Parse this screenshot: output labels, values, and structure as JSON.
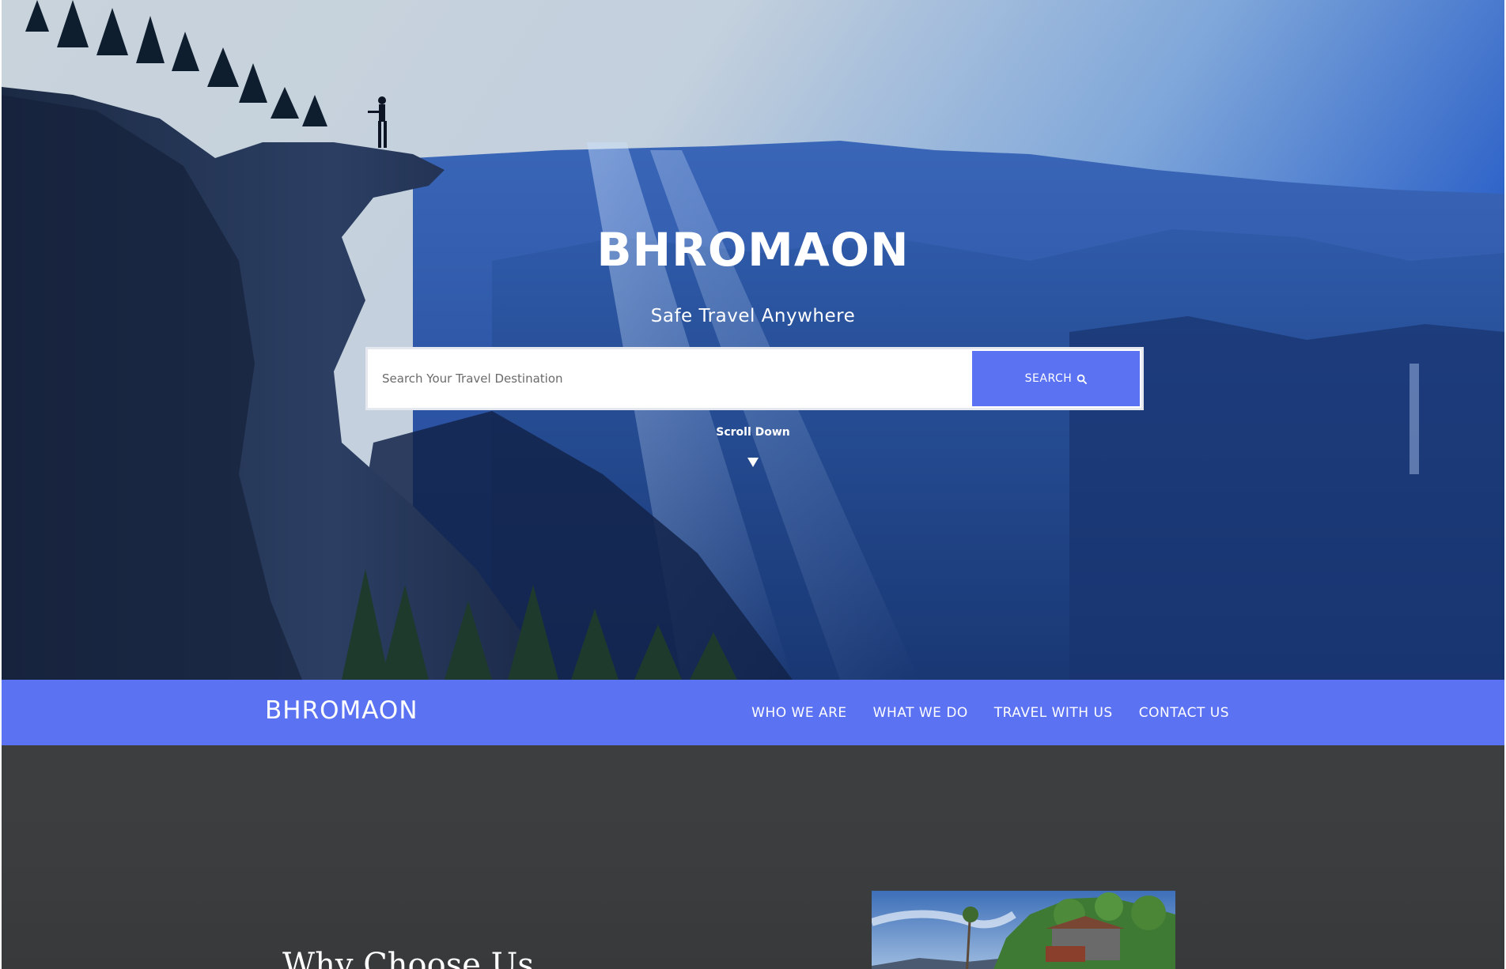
{
  "hero": {
    "title": "BHROMAON",
    "subtitle": "Safe Travel Anywhere",
    "search": {
      "placeholder": "Search Your Travel Destination",
      "button_label": "SEARCH",
      "button_icon": "search-icon"
    },
    "scroll_label": "Scroll Down",
    "scroll_icon": "triangle-down-icon"
  },
  "navbar": {
    "logo": "BHROMAON",
    "links": [
      "WHO WE ARE",
      "WHAT WE DO",
      "TRAVEL WITH US",
      "CONTACT US"
    ]
  },
  "section": {
    "title": "Why Choose Us"
  },
  "colors": {
    "accent": "#5b72f2",
    "section_bg": "#3c3d3f",
    "text_light": "#ffffff"
  }
}
